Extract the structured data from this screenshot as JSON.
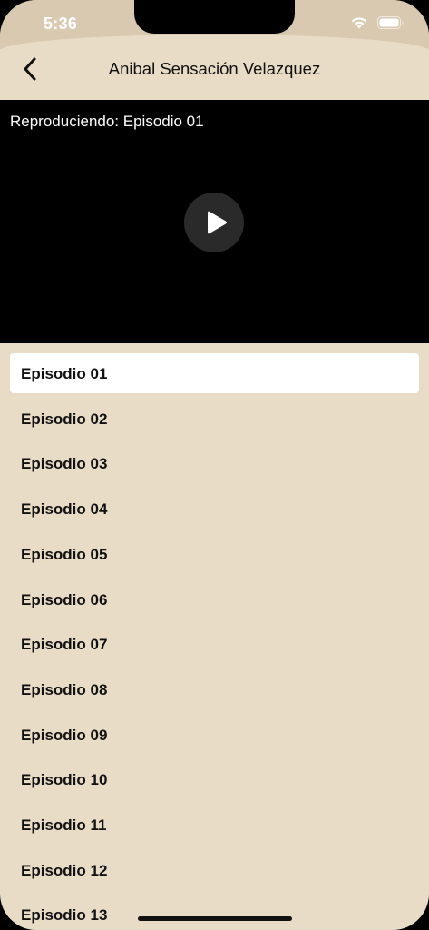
{
  "status_bar": {
    "time": "5:36",
    "wifi_icon": "wifi-icon",
    "battery_icon": "battery-icon"
  },
  "nav": {
    "back_icon": "chevron-left-icon",
    "title": "Anibal Sensación Velazquez"
  },
  "player": {
    "now_playing": "Reproduciendo: Episodio 01",
    "play_icon": "play-icon"
  },
  "episodes": {
    "selected_index": 0,
    "items": [
      {
        "label": "Episodio 01"
      },
      {
        "label": "Episodio 02"
      },
      {
        "label": "Episodio 03"
      },
      {
        "label": "Episodio 04"
      },
      {
        "label": "Episodio 05"
      },
      {
        "label": "Episodio 06"
      },
      {
        "label": "Episodio 07"
      },
      {
        "label": "Episodio 08"
      },
      {
        "label": "Episodio 09"
      },
      {
        "label": "Episodio 10"
      },
      {
        "label": "Episodio 11"
      },
      {
        "label": "Episodio 12"
      },
      {
        "label": "Episodio 13"
      }
    ]
  },
  "colors": {
    "background": "#e9dcc7",
    "status_bar": "#d8c9b0",
    "player_bg": "#000000",
    "selected_row": "#ffffff"
  }
}
